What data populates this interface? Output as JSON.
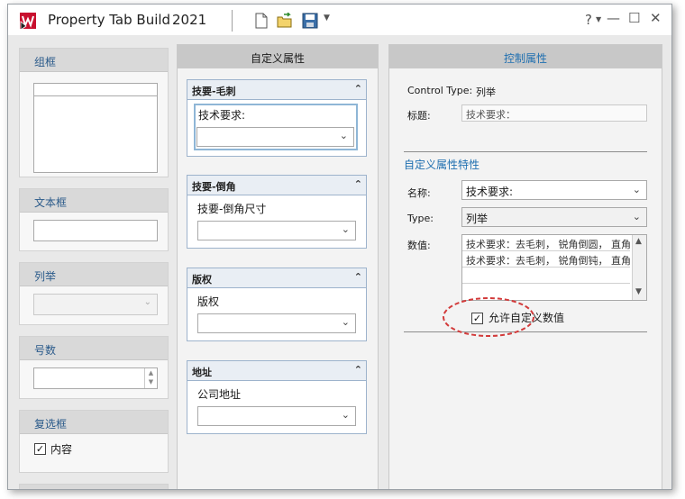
{
  "window": {
    "title": "Property Tab Builde",
    "version": "2021",
    "help_label": "?",
    "minimize_label": "—",
    "maximize_label": "☐",
    "close_label": "✕"
  },
  "palette": {
    "groups": [
      {
        "label": "组框"
      },
      {
        "label": "文本框"
      },
      {
        "label": "列举"
      },
      {
        "label": "号数"
      },
      {
        "label": "复选框",
        "checkbox_label": "内容"
      }
    ]
  },
  "middle": {
    "header": "自定义属性",
    "groups": [
      {
        "title": "技要-毛刺",
        "field_label": "技术要求:"
      },
      {
        "title": "技要-倒角",
        "field_label": "技要-倒角尺寸"
      },
      {
        "title": "版权",
        "field_label": "版权"
      },
      {
        "title": "地址",
        "field_label": "公司地址"
      }
    ]
  },
  "right": {
    "header": "控制属性",
    "control_type_label": "Control Type:",
    "control_type_value": "列举",
    "caption_label": "标题:",
    "caption_value": "技术要求：",
    "section_title": "自定义属性特性",
    "name_label": "名称:",
    "name_value": "技术要求:",
    "type_label": "Type:",
    "type_value": "列举",
    "values_label": "数值:",
    "values": [
      "技术要求：去毛刺， 锐角倒圆， 直角倒",
      "技术要求：去毛刺， 锐角倒钝， 直角倒"
    ],
    "allow_custom_label": "允许自定义数值"
  },
  "colors": {
    "accent_blue": "#1f6fb0",
    "annotation_red": "#d23a3a"
  }
}
